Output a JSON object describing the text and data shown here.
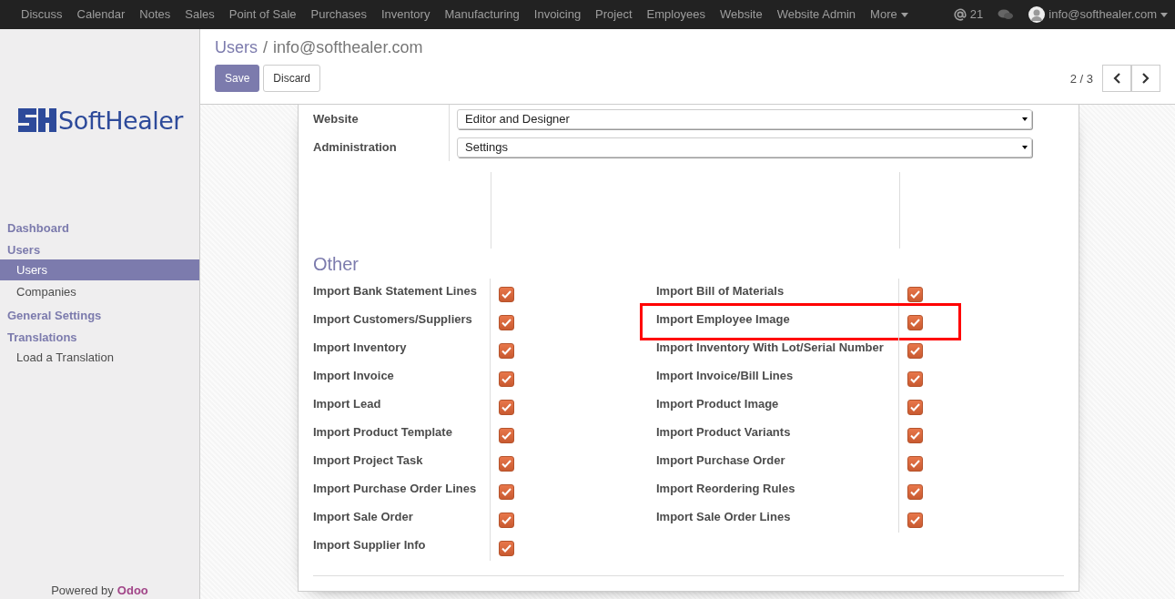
{
  "navbar": {
    "apps": [
      "Discuss",
      "Calendar",
      "Notes",
      "Sales",
      "Point of Sale",
      "Purchases",
      "Inventory",
      "Manufacturing",
      "Invoicing",
      "Project",
      "Employees",
      "Website",
      "Website Admin"
    ],
    "more": "More",
    "mentions": "21",
    "user": "info@softhealer.com"
  },
  "breadcrumb": {
    "parent": "Users",
    "separator": "/",
    "current": "info@softhealer.com"
  },
  "buttons": {
    "save": "Save",
    "discard": "Discard"
  },
  "pager": "2 / 3",
  "sidebar": {
    "logo": "SoftHealer",
    "sections": [
      {
        "title": "Dashboard"
      },
      {
        "title": "Users",
        "items": [
          {
            "label": "Users",
            "selected": true
          },
          {
            "label": "Companies",
            "selected": false
          }
        ]
      },
      {
        "title": "General Settings"
      },
      {
        "title": "Translations",
        "items": [
          {
            "label": "Load a Translation",
            "selected": false
          }
        ]
      }
    ],
    "footer": {
      "text": "Powered by",
      "brand": "Odoo"
    }
  },
  "form": {
    "fields": [
      {
        "label": "Website",
        "value": "Editor and Designer"
      },
      {
        "label": "Administration",
        "value": "Settings"
      }
    ],
    "other": {
      "title": "Other",
      "columns": [
        [
          {
            "label": "Import Bank Statement Lines",
            "checked": true,
            "highlighted": false
          },
          {
            "label": "Import Customers/Suppliers",
            "checked": true,
            "highlighted": false
          },
          {
            "label": "Import Inventory",
            "checked": true,
            "highlighted": false
          },
          {
            "label": "Import Invoice",
            "checked": true,
            "highlighted": false
          },
          {
            "label": "Import Lead",
            "checked": true,
            "highlighted": false
          },
          {
            "label": "Import Product Template",
            "checked": true,
            "highlighted": false
          },
          {
            "label": "Import Project Task",
            "checked": true,
            "highlighted": false
          },
          {
            "label": "Import Purchase Order Lines",
            "checked": true,
            "highlighted": false
          },
          {
            "label": "Import Sale Order",
            "checked": true,
            "highlighted": false
          },
          {
            "label": "Import Supplier Info",
            "checked": true,
            "highlighted": false
          }
        ],
        [
          {
            "label": "Import Bill of Materials",
            "checked": true,
            "highlighted": false
          },
          {
            "label": "Import Employee Image",
            "checked": true,
            "highlighted": true
          },
          {
            "label": "Import Inventory With Lot/Serial Number",
            "checked": true,
            "highlighted": false
          },
          {
            "label": "Import Invoice/Bill Lines",
            "checked": true,
            "highlighted": false
          },
          {
            "label": "Import Product Image",
            "checked": true,
            "highlighted": false
          },
          {
            "label": "Import Product Variants",
            "checked": true,
            "highlighted": false
          },
          {
            "label": "Import Purchase Order",
            "checked": true,
            "highlighted": false
          },
          {
            "label": "Import Reordering Rules",
            "checked": true,
            "highlighted": false
          },
          {
            "label": "Import Sale Order Lines",
            "checked": true,
            "highlighted": false
          }
        ]
      ]
    }
  }
}
